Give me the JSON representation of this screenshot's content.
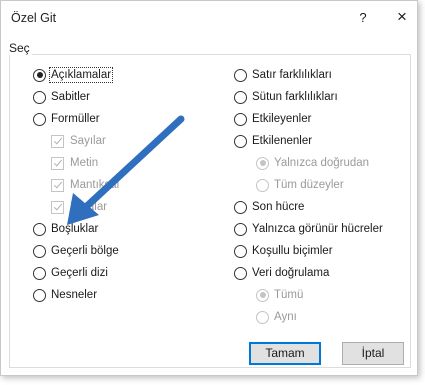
{
  "dialog": {
    "title": "Özel Git",
    "help": "?",
    "close": "×",
    "group_label": "Seç"
  },
  "left_options": [
    {
      "label": "Açıklamalar",
      "type": "radio",
      "checked": true
    },
    {
      "label": "Sabitler",
      "type": "radio"
    },
    {
      "label": "Formüller",
      "type": "radio"
    },
    {
      "label": "Sayılar",
      "type": "check",
      "checked": true,
      "disabled": true
    },
    {
      "label": "Metin",
      "type": "check",
      "checked": true,
      "disabled": true
    },
    {
      "label": "Mantıksal",
      "type": "check",
      "checked": true,
      "disabled": true
    },
    {
      "label": "Hatalar",
      "type": "check",
      "checked": true,
      "disabled": true
    },
    {
      "label": "Boşluklar",
      "type": "radio"
    },
    {
      "label": "Geçerli bölge",
      "type": "radio"
    },
    {
      "label": "Geçerli dizi",
      "type": "radio"
    },
    {
      "label": "Nesneler",
      "type": "radio"
    }
  ],
  "right_options": [
    {
      "label": "Satır farklılıkları",
      "type": "radio"
    },
    {
      "label": "Sütun farklılıkları",
      "type": "radio"
    },
    {
      "label": "Etkileyenler",
      "type": "radio"
    },
    {
      "label": "Etkilenenler",
      "type": "radio"
    },
    {
      "label": "Yalnızca doğrudan",
      "type": "radio",
      "checked": true,
      "disabled": true
    },
    {
      "label": "Tüm düzeyler",
      "type": "radio",
      "disabled": true
    },
    {
      "label": "Son hücre",
      "type": "radio"
    },
    {
      "label": "Yalnızca görünür hücreler",
      "type": "radio"
    },
    {
      "label": "Koşullu biçimler",
      "type": "radio"
    },
    {
      "label": "Veri doğrulama",
      "type": "radio"
    },
    {
      "label": "Tümü",
      "type": "radio",
      "checked": true,
      "disabled": true
    },
    {
      "label": "Aynı",
      "type": "radio",
      "disabled": true
    }
  ],
  "buttons": {
    "ok": "Tamam",
    "cancel": "İptal"
  },
  "annotation": {
    "color": "#2f6fbe"
  }
}
